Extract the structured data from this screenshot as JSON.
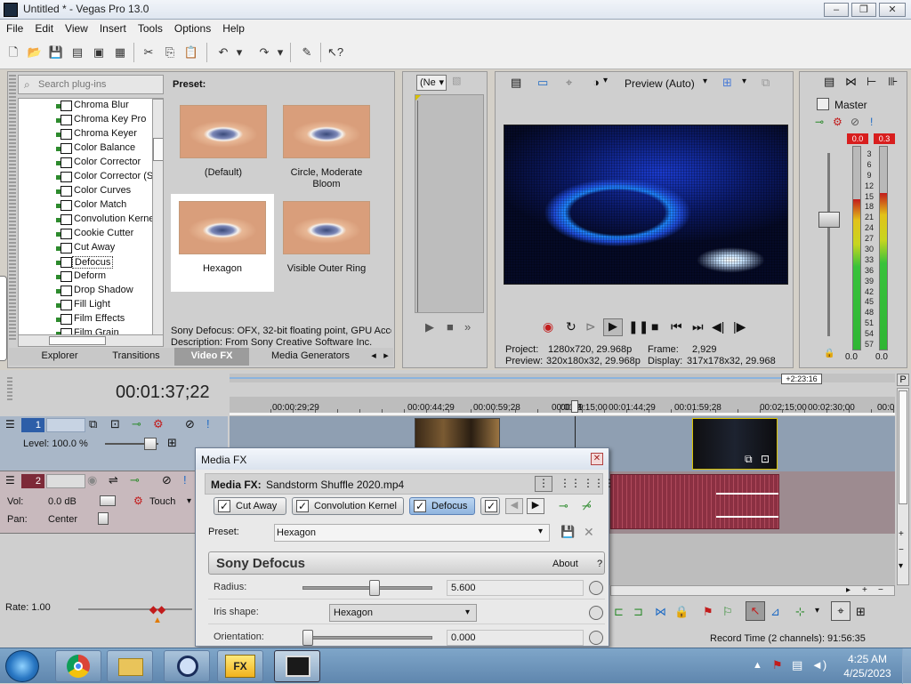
{
  "window": {
    "title": "Untitled * - Vegas Pro 13.0",
    "minimize": "‒",
    "restore": "❐",
    "close": "✕"
  },
  "menu": [
    "File",
    "Edit",
    "View",
    "Insert",
    "Tools",
    "Options",
    "Help"
  ],
  "plugins": {
    "search_placeholder": "Search plug-ins",
    "items": [
      "Chroma Blur",
      "Chroma Key Pro",
      "Chroma Keyer",
      "Color Balance",
      "Color Corrector",
      "Color Corrector (S",
      "Color Curves",
      "Color Match",
      "Convolution Kerne",
      "Cookie Cutter",
      "Cut Away",
      "Defocus",
      "Deform",
      "Drop Shadow",
      "Fill Light",
      "Film Effects",
      "Film Grain"
    ],
    "selected": "Defocus"
  },
  "presets": {
    "heading": "Preset:",
    "items": [
      "(Default)",
      "Circle, Moderate Bloom",
      "Hexagon",
      "Visible Outer Ring"
    ],
    "selected": "Hexagon",
    "info_line1": "Sony Defocus: OFX, 32-bit floating point, GPU Acce",
    "info_line2": "Description: From Sony Creative Software Inc."
  },
  "tabs": [
    "Explorer",
    "Transitions",
    "Video FX",
    "Media Generators"
  ],
  "active_tab": "Video FX",
  "trimmer": {
    "dropdown": "(Ne"
  },
  "preview": {
    "quality": "Preview (Auto)",
    "project_label": "Project:",
    "project_value": "1280x720, 29.968p",
    "frame_label": "Frame:",
    "frame_value": "2,929",
    "preview_label": "Preview:",
    "preview_value": "320x180x32, 29.968p",
    "display_label": "Display:",
    "display_value": "317x178x32, 29.968"
  },
  "master": {
    "title": "Master",
    "peak_left": "0.0",
    "peak_right": "0.3",
    "scale": [
      "3",
      "6",
      "9",
      "12",
      "15",
      "18",
      "21",
      "24",
      "27",
      "30",
      "33",
      "36",
      "39",
      "42",
      "45",
      "48",
      "51",
      "54",
      "57"
    ],
    "bottom_left": "0.0",
    "bottom_right": "0.0",
    "bottom_center": "0.0",
    "level_left": 0.74,
    "level_right": 0.77
  },
  "timeline": {
    "timecode": "00:01:37;22",
    "marker": "+2:23:16",
    "ruler": [
      "00:00:29;29",
      "00:00:44;29",
      "00:00:59;28",
      "00:01:15;00",
      "00:01:2",
      "9",
      "00:01:44;29",
      "00:01:59;28",
      "00:02:15;00",
      "00:02:30;00",
      "00:0"
    ],
    "video_track": {
      "number": "1",
      "level": "Level: 100.0 %"
    },
    "audio_track": {
      "number": "2",
      "vol_label": "Vol:",
      "vol_value": "0.0 dB",
      "pan_label": "Pan:",
      "pan_value": "Center",
      "touch": "Touch"
    },
    "rate": "Rate: 1.00",
    "record_time": "Record Time (2 channels): 91:56:35"
  },
  "mediafx": {
    "title": "Media FX",
    "label": "Media FX:",
    "file": "Sandstorm Shuffle 2020.mp4",
    "chain": [
      "Cut Away",
      "Convolution Kernel",
      "Defocus"
    ],
    "preset_label": "Preset:",
    "preset_value": "Hexagon",
    "plugin_name": "Sony Defocus",
    "about": "About",
    "help": "?",
    "params": [
      {
        "label": "Radius:",
        "value": "5.600",
        "fraction": 0.56
      },
      {
        "label": "Iris shape:",
        "value": "Hexagon"
      },
      {
        "label": "Orientation:",
        "value": "0.000",
        "fraction": 0.0
      }
    ]
  },
  "taskbar": {
    "apps": [
      "start",
      "chrome",
      "explorer",
      "search",
      "fx",
      "vegas"
    ],
    "fx_label": "FX",
    "time": "4:25 AM",
    "date": "4/25/2023"
  },
  "colors": {
    "accent": "#3d79c8",
    "meter_peak": "#d81e1e",
    "video_track": "#2d5ea8",
    "audio_track": "#7d2a38"
  }
}
